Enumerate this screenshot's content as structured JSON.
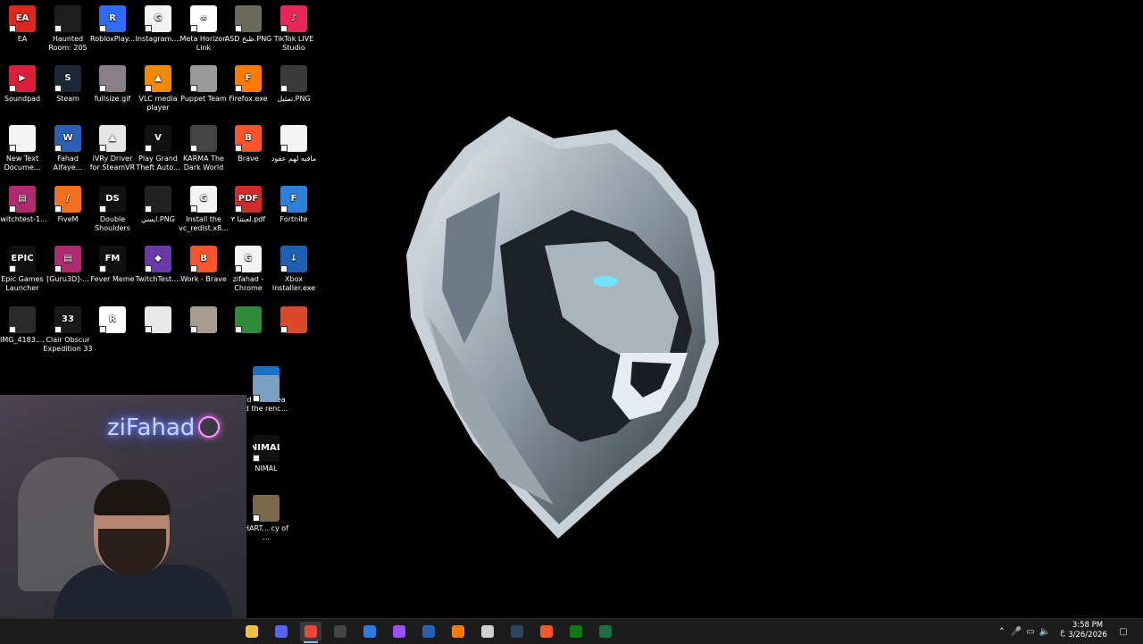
{
  "desktop_icons": [
    {
      "label": "EA",
      "color": "#e0271f",
      "glyph": "EA"
    },
    {
      "label": "Haunted Room: 205",
      "color": "#1e1e1e",
      "glyph": ""
    },
    {
      "label": "RobloxPlay...",
      "color": "#2f6bff",
      "glyph": "R"
    },
    {
      "label": "Instagram....",
      "color": "#f3f3f3",
      "glyph": "G"
    },
    {
      "label": "Meta Horizon Link",
      "color": "#ffffff",
      "glyph": "∞"
    },
    {
      "label": "ASD طبخ.PNG",
      "color": "#6a6a5a",
      "glyph": ""
    },
    {
      "label": "TikTok LIVE Studio",
      "color": "#e8265a",
      "glyph": "♪"
    },
    {
      "label": "Soundpad",
      "color": "#d8203a",
      "glyph": "▶"
    },
    {
      "label": "Steam",
      "color": "#1b2838",
      "glyph": "S"
    },
    {
      "label": "fullsize.gif",
      "color": "#8a7f86",
      "glyph": ""
    },
    {
      "label": "VLC media player",
      "color": "#f08a00",
      "glyph": "▲"
    },
    {
      "label": "Puppet Team",
      "color": "#9a9a9a",
      "glyph": ""
    },
    {
      "label": "Firefox.exe",
      "color": "#ff7b00",
      "glyph": "F"
    },
    {
      "label": "تمثيل.PNG",
      "color": "#3a3a3a",
      "glyph": ""
    },
    {
      "label": "New Text Docume...",
      "color": "#f5f5f5",
      "glyph": ""
    },
    {
      "label": "Fahad Alfaye...",
      "color": "#2b5fb4",
      "glyph": "W"
    },
    {
      "label": "iVRy Driver for SteamVR",
      "color": "#e6e6e6",
      "glyph": "▲"
    },
    {
      "label": "Play Grand Theft Auto...",
      "color": "#111",
      "glyph": "V"
    },
    {
      "label": "KARMA The Dark World",
      "color": "#444",
      "glyph": ""
    },
    {
      "label": "Brave",
      "color": "#fb542b",
      "glyph": "B"
    },
    {
      "label": "مافيه لهم عقود",
      "color": "#f5f5f5",
      "glyph": ""
    },
    {
      "label": "twitchtest-1...",
      "color": "#b02a70",
      "glyph": "▤"
    },
    {
      "label": "FiveM",
      "color": "#f37021",
      "glyph": "/"
    },
    {
      "label": "Double Shoulders",
      "color": "#111",
      "glyph": "DS"
    },
    {
      "label": "ايسي.PNG",
      "color": "#222",
      "glyph": ""
    },
    {
      "label": "Install the vc_redist.x8...",
      "color": "#f3f3f3",
      "glyph": "G"
    },
    {
      "label": "لعبتنا ٣.pdf",
      "color": "#d12b2b",
      "glyph": "PDF"
    },
    {
      "label": "Fortnite",
      "color": "#2d7fd8",
      "glyph": "F"
    },
    {
      "label": "Epic Games Launcher",
      "color": "#111",
      "glyph": "EPIC"
    },
    {
      "label": "[Guru3D]-...",
      "color": "#b02a70",
      "glyph": "▤"
    },
    {
      "label": "Fever Meme",
      "color": "#111",
      "glyph": "FM"
    },
    {
      "label": "TwitchTest....",
      "color": "#6a3aa8",
      "glyph": "◆"
    },
    {
      "label": "Work - Brave",
      "color": "#fb542b",
      "glyph": "B"
    },
    {
      "label": "zifahad - Chrome",
      "color": "#f3f3f3",
      "glyph": "G"
    },
    {
      "label": "Xbox Installer.exe",
      "color": "#1c5fb5",
      "glyph": "↓"
    },
    {
      "label": "IMG_4183....",
      "color": "#2a2a2a",
      "glyph": ""
    },
    {
      "label": "Clair Obscur Expedition 33",
      "color": "#1a1a1a",
      "glyph": "33"
    },
    {
      "label": "",
      "color": "#fff",
      "glyph": "R"
    },
    {
      "label": "",
      "color": "#e8e8e8",
      "glyph": ""
    },
    {
      "label": "",
      "color": "#a89c8c",
      "glyph": ""
    },
    {
      "label": "",
      "color": "#2c8a3a",
      "glyph": ""
    },
    {
      "label": "",
      "color": "#d84a2a",
      "glyph": ""
    },
    {
      "label": "d of the ea",
      "color": "#1a72c8",
      "glyph": "◎"
    },
    {
      "label": "d the renc...",
      "color": "#7aa0c0",
      "glyph": ""
    },
    {
      "label": "NIMAL",
      "color": "#111",
      "glyph": "NIMAL"
    },
    {
      "label": "HART... cy of ...",
      "color": "#7a6a4a",
      "glyph": ""
    }
  ],
  "webcam": {
    "neon_text": "ziFahad"
  },
  "taskbar": {
    "apps": [
      {
        "name": "file-explorer-icon",
        "color": "#f0c040"
      },
      {
        "name": "discord-icon",
        "color": "#5865f2"
      },
      {
        "name": "chrome-icon",
        "color": "#e8453c"
      },
      {
        "name": "obs-icon",
        "color": "#444"
      },
      {
        "name": "store-icon",
        "color": "#2b7de1"
      },
      {
        "name": "messenger-icon",
        "color": "#9b4dff"
      },
      {
        "name": "word-icon",
        "color": "#2b5fb4"
      },
      {
        "name": "firefox-icon",
        "color": "#ff7b00"
      },
      {
        "name": "app-icon",
        "color": "#cfcfcf"
      },
      {
        "name": "steam-icon",
        "color": "#2a475e"
      },
      {
        "name": "brave-icon",
        "color": "#fb542b"
      },
      {
        "name": "xbox-icon",
        "color": "#107c10"
      },
      {
        "name": "excel-icon",
        "color": "#1d6f42"
      }
    ],
    "active_app": 2,
    "lang": "ع",
    "time": "3:58 PM",
    "date": "3/26/2026"
  }
}
